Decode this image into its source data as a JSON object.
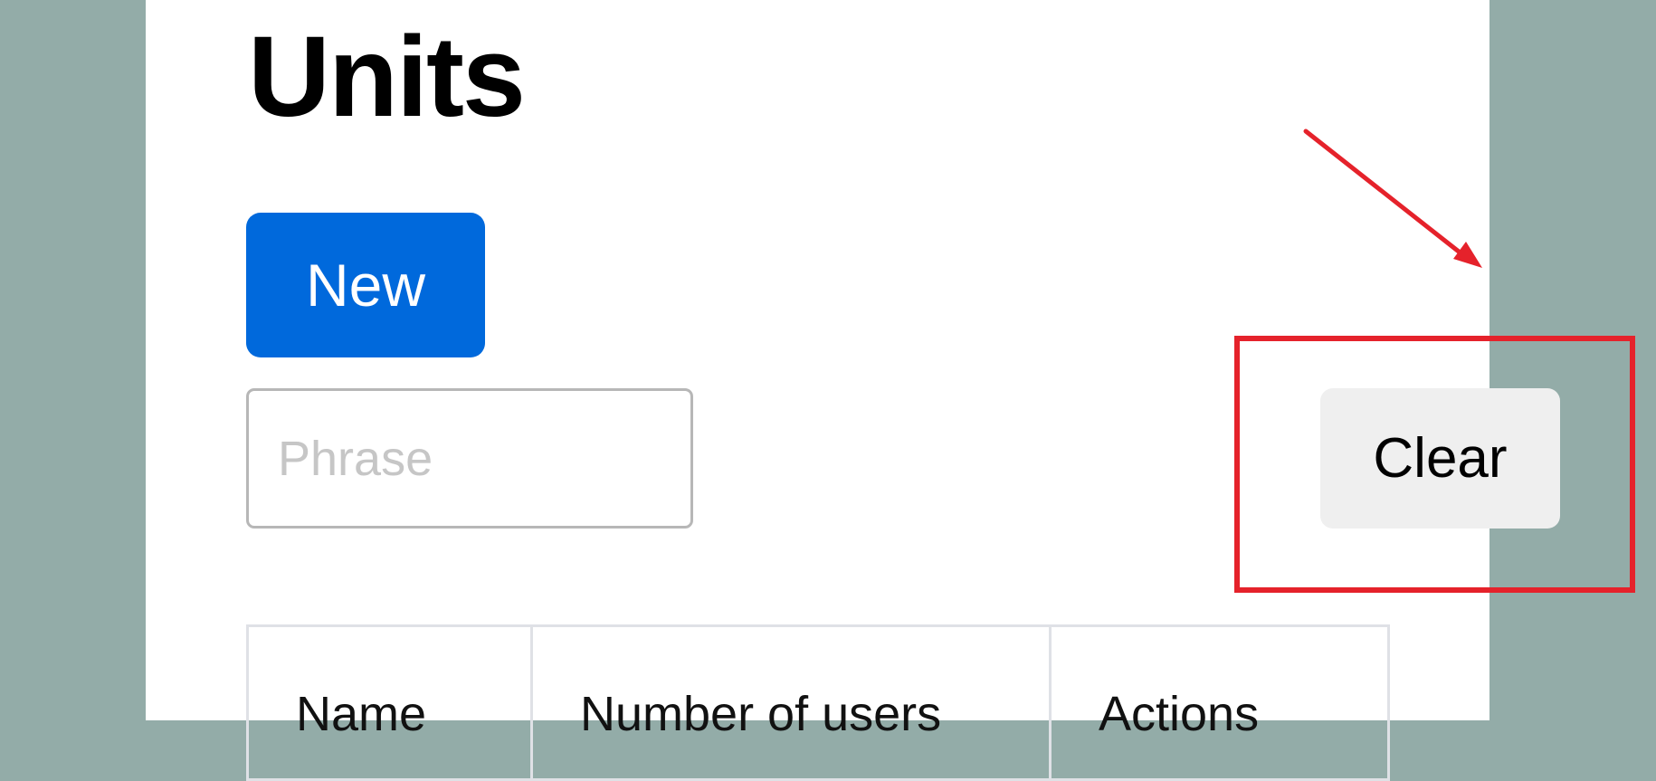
{
  "page": {
    "title": "Units"
  },
  "toolbar": {
    "new_label": "New",
    "clear_label": "Clear"
  },
  "search": {
    "placeholder": "Phrase",
    "value": ""
  },
  "table": {
    "columns": [
      "Name",
      "Number of users",
      "Actions"
    ]
  },
  "colors": {
    "background": "#93aca8",
    "panel": "#ffffff",
    "primary_button": "#0069dc",
    "secondary_button": "#efefef",
    "annotation": "#e5222b"
  },
  "annotation": {
    "shape": "rectangle-with-arrow",
    "target": "clear-button"
  }
}
